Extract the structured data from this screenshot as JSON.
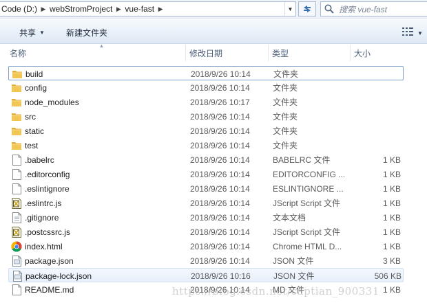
{
  "address_bar": {
    "crumbs": [
      "Code (D:)",
      "webStromProject",
      "vue-fast"
    ]
  },
  "search": {
    "placeholder": "搜索 vue-fast"
  },
  "toolbar": {
    "share_label": "共享",
    "new_folder_label": "新建文件夹"
  },
  "columns": {
    "name": "名称",
    "date": "修改日期",
    "type": "类型",
    "size": "大小"
  },
  "files": [
    {
      "name": "build",
      "date": "2018/9/26 10:14",
      "type": "文件夹",
      "size": "",
      "icon": "folder-icon"
    },
    {
      "name": "config",
      "date": "2018/9/26 10:14",
      "type": "文件夹",
      "size": "",
      "icon": "folder-icon"
    },
    {
      "name": "node_modules",
      "date": "2018/9/26 10:17",
      "type": "文件夹",
      "size": "",
      "icon": "folder-icon"
    },
    {
      "name": "src",
      "date": "2018/9/26 10:14",
      "type": "文件夹",
      "size": "",
      "icon": "folder-icon"
    },
    {
      "name": "static",
      "date": "2018/9/26 10:14",
      "type": "文件夹",
      "size": "",
      "icon": "folder-icon"
    },
    {
      "name": "test",
      "date": "2018/9/26 10:14",
      "type": "文件夹",
      "size": "",
      "icon": "folder-icon"
    },
    {
      "name": ".babelrc",
      "date": "2018/9/26 10:14",
      "type": "BABELRC 文件",
      "size": "1 KB",
      "icon": "blank-file-icon"
    },
    {
      "name": ".editorconfig",
      "date": "2018/9/26 10:14",
      "type": "EDITORCONFIG ...",
      "size": "1 KB",
      "icon": "blank-file-icon"
    },
    {
      "name": ".eslintignore",
      "date": "2018/9/26 10:14",
      "type": "ESLINTIGNORE ...",
      "size": "1 KB",
      "icon": "blank-file-icon"
    },
    {
      "name": ".eslintrc.js",
      "date": "2018/9/26 10:14",
      "type": "JScript Script 文件",
      "size": "1 KB",
      "icon": "jscript-file-icon"
    },
    {
      "name": ".gitignore",
      "date": "2018/9/26 10:14",
      "type": "文本文档",
      "size": "1 KB",
      "icon": "text-file-icon"
    },
    {
      "name": ".postcssrc.js",
      "date": "2018/9/26 10:14",
      "type": "JScript Script 文件",
      "size": "1 KB",
      "icon": "jscript-file-icon"
    },
    {
      "name": "index.html",
      "date": "2018/9/26 10:14",
      "type": "Chrome HTML D...",
      "size": "1 KB",
      "icon": "chrome-html-icon"
    },
    {
      "name": "package.json",
      "date": "2018/9/26 10:14",
      "type": "JSON 文件",
      "size": "3 KB",
      "icon": "json-file-icon"
    },
    {
      "name": "package-lock.json",
      "date": "2018/9/26 10:16",
      "type": "JSON 文件",
      "size": "506 KB",
      "icon": "json-file-icon"
    },
    {
      "name": "README.md",
      "date": "2018/9/26 10:14",
      "type": "MD 文件",
      "size": "1 KB",
      "icon": "blank-file-icon"
    }
  ],
  "selected_file": "build",
  "hovered_file": "package-lock.json",
  "watermark": "https://blog.csdn.net/captian_900331",
  "colors": {
    "folder": "#e8b63f",
    "selection_border": "#7da2ce",
    "hover_bg": "#e7f0fb",
    "toolbar_bg": "#dfe9f5"
  }
}
